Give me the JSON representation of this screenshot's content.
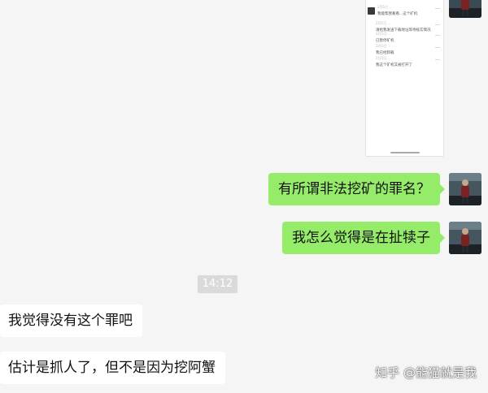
{
  "chat": {
    "image_message": {
      "entries": [
        {
          "time": "2月5日 ...",
          "text": "我能帮我看看...这个矿机"
        },
        {
          "time": "2月5日 ...",
          "text": "请给我发送下载地址等待核实情况"
        },
        {
          "time": "2月5日 ...",
          "text": "已暂停矿机"
        },
        {
          "time": "2月5日 ...",
          "text": "我已经卸载"
        },
        {
          "time": "2月5日 ...",
          "text": "我这个矿机又被打开了"
        }
      ]
    },
    "messages_me": [
      {
        "text": "有所谓非法挖矿的罪名？"
      },
      {
        "text": "我怎么觉得是在扯犊子"
      }
    ],
    "timestamp": "14:12",
    "messages_them": [
      {
        "text": "我觉得没有这个罪吧"
      },
      {
        "text": "估计是抓人了，但不是因为挖阿蟹"
      }
    ]
  },
  "watermark": "知乎 @能猫就是我",
  "colors": {
    "background": "#f5f5f5",
    "bubble_me": "#95ec69",
    "bubble_them": "#ffffff",
    "timestamp_bg": "#dadada"
  }
}
